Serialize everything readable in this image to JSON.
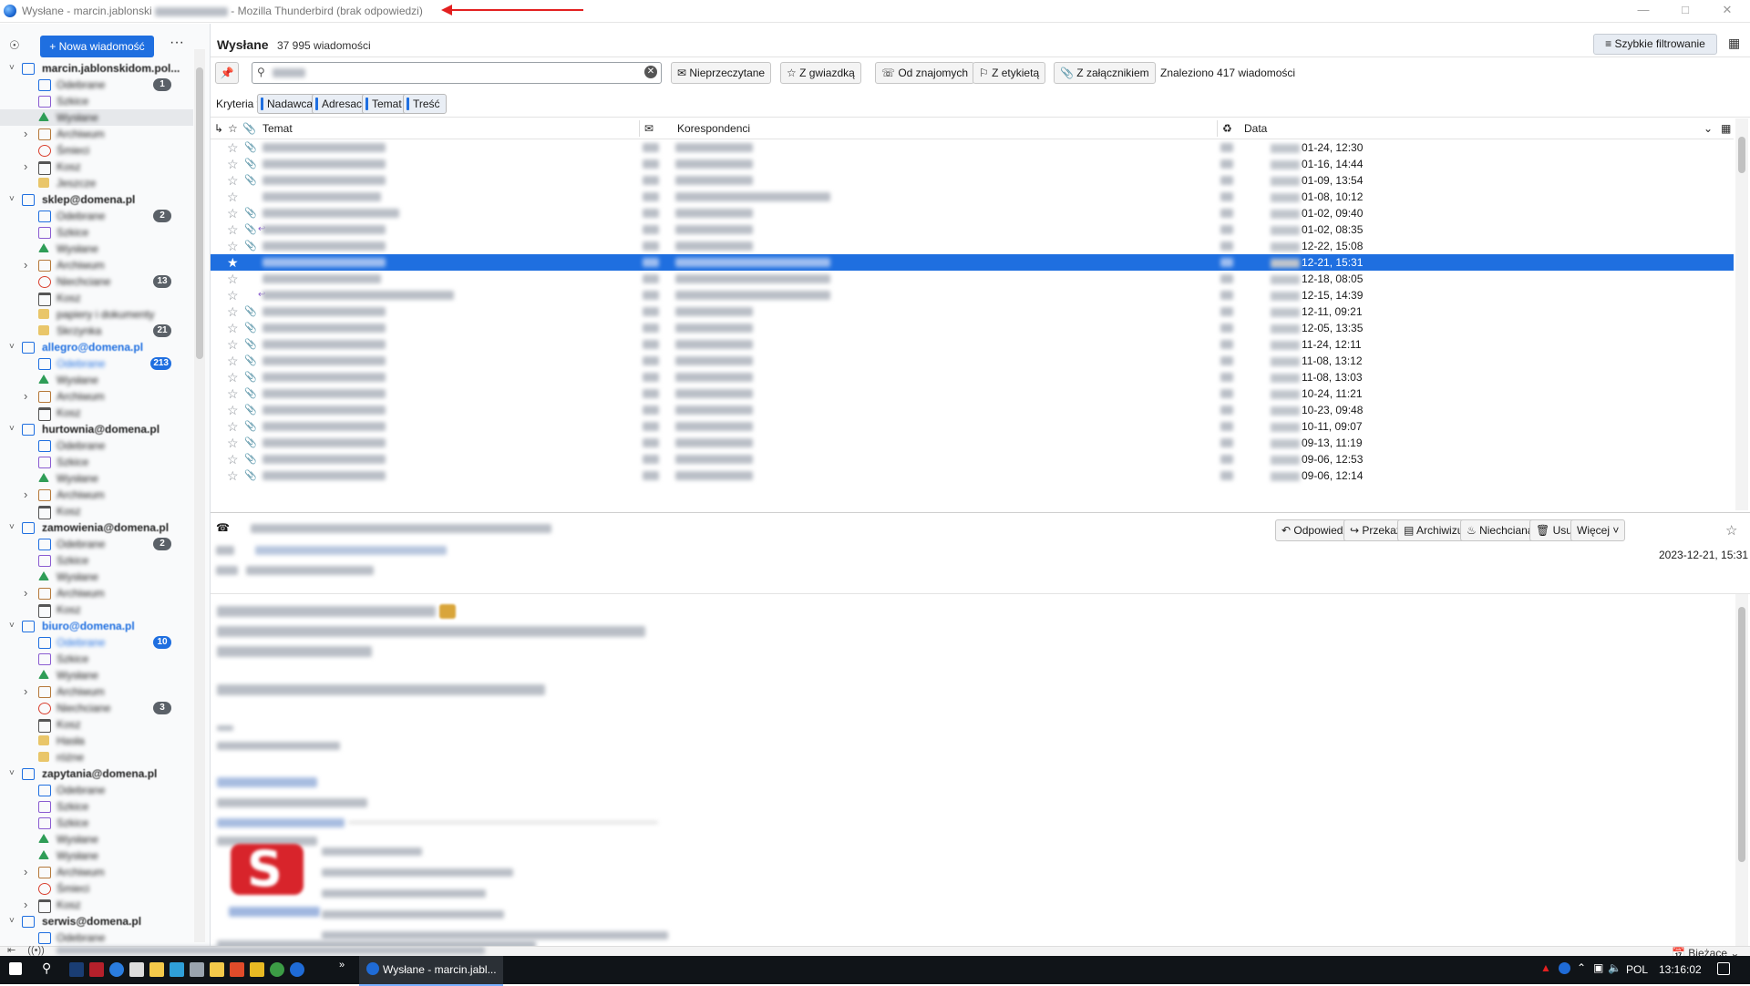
{
  "window": {
    "title": "Wysłane - marcin.jablonski",
    "title_suffix": "- Mozilla Thunderbird (brak odpowiedzi)",
    "accent": "#1f6fe0"
  },
  "folder_pane": {
    "new_message": "+ Nowa wiadomość",
    "menu": "···",
    "items": [
      {
        "type": "acct",
        "label": "marcin.jablonskidom.pol...",
        "expanded": true
      },
      {
        "type": "folder",
        "label": "Odebrane",
        "icon": "inbox-icon",
        "badge": "1"
      },
      {
        "type": "folder",
        "label": "Szkice",
        "icon": "drafts-icon"
      },
      {
        "type": "folder",
        "label": "Wysłane",
        "icon": "sent-icon",
        "selected": true
      },
      {
        "type": "folder",
        "label": "Archiwum",
        "icon": "archive-icon",
        "twisty": true
      },
      {
        "type": "folder",
        "label": "Śmieci",
        "icon": "junk-icon"
      },
      {
        "type": "folder",
        "label": "Kosz",
        "icon": "trash-icon",
        "twisty": true
      },
      {
        "type": "folder",
        "label": "Jeszcze",
        "icon": "folder-icon"
      },
      {
        "type": "acct",
        "label": "sklep@domena.pl",
        "expanded": true
      },
      {
        "type": "folder",
        "label": "Odebrane",
        "icon": "inbox-icon",
        "badge": "2"
      },
      {
        "type": "folder",
        "label": "Szkice",
        "icon": "drafts-icon"
      },
      {
        "type": "folder",
        "label": "Wysłane",
        "icon": "sent-icon"
      },
      {
        "type": "folder",
        "label": "Archiwum",
        "icon": "archive-icon",
        "twisty": true
      },
      {
        "type": "folder",
        "label": "Niechciane",
        "icon": "junk-icon",
        "badge": "13"
      },
      {
        "type": "folder",
        "label": "Kosz",
        "icon": "trash-icon"
      },
      {
        "type": "folder",
        "label": "papiery i dokumenty",
        "icon": "folder-icon"
      },
      {
        "type": "folder",
        "label": "Skrzynka",
        "icon": "folder-icon",
        "badge": "21"
      },
      {
        "type": "acct",
        "label": "allegro@domena.pl",
        "expanded": true,
        "blue": true
      },
      {
        "type": "folder",
        "label": "Odebrane",
        "icon": "inbox-icon",
        "badge": "213",
        "badgeBlue": true,
        "blue": true
      },
      {
        "type": "folder",
        "label": "Wysłane",
        "icon": "sent-icon"
      },
      {
        "type": "folder",
        "label": "Archiwum",
        "icon": "archive-icon",
        "twisty": true
      },
      {
        "type": "folder",
        "label": "Kosz",
        "icon": "trash-icon"
      },
      {
        "type": "acct",
        "label": "hurtownia@domena.pl",
        "expanded": true
      },
      {
        "type": "folder",
        "label": "Odebrane",
        "icon": "inbox-icon"
      },
      {
        "type": "folder",
        "label": "Szkice",
        "icon": "drafts-icon"
      },
      {
        "type": "folder",
        "label": "Wysłane",
        "icon": "sent-icon"
      },
      {
        "type": "folder",
        "label": "Archiwum",
        "icon": "archive-icon",
        "twisty": true
      },
      {
        "type": "folder",
        "label": "Kosz",
        "icon": "trash-icon"
      },
      {
        "type": "acct",
        "label": "zamowienia@domena.pl",
        "expanded": true
      },
      {
        "type": "folder",
        "label": "Odebrane",
        "icon": "inbox-icon",
        "badge": "2"
      },
      {
        "type": "folder",
        "label": "Szkice",
        "icon": "drafts-icon"
      },
      {
        "type": "folder",
        "label": "Wysłane",
        "icon": "sent-icon"
      },
      {
        "type": "folder",
        "label": "Archiwum",
        "icon": "archive-icon",
        "twisty": true
      },
      {
        "type": "folder",
        "label": "Kosz",
        "icon": "trash-icon"
      },
      {
        "type": "acct",
        "label": "biuro@domena.pl",
        "expanded": true,
        "blue": true
      },
      {
        "type": "folder",
        "label": "Odebrane",
        "icon": "inbox-icon",
        "badge": "10",
        "badgeBlue": true,
        "blue": true
      },
      {
        "type": "folder",
        "label": "Szkice",
        "icon": "drafts-icon"
      },
      {
        "type": "folder",
        "label": "Wysłane",
        "icon": "sent-icon"
      },
      {
        "type": "folder",
        "label": "Archiwum",
        "icon": "archive-icon",
        "twisty": true
      },
      {
        "type": "folder",
        "label": "Niechciane",
        "icon": "junk-icon",
        "badge": "3"
      },
      {
        "type": "folder",
        "label": "Kosz",
        "icon": "trash-icon"
      },
      {
        "type": "folder",
        "label": "Hasła",
        "icon": "folder-icon"
      },
      {
        "type": "folder",
        "label": "różne",
        "icon": "folder-icon"
      },
      {
        "type": "acct",
        "label": "zapytania@domena.pl",
        "expanded": true
      },
      {
        "type": "folder",
        "label": "Odebrane",
        "icon": "inbox-icon"
      },
      {
        "type": "folder",
        "label": "Szkice",
        "icon": "drafts-icon"
      },
      {
        "type": "folder",
        "label": "Szkice",
        "icon": "drafts-icon"
      },
      {
        "type": "folder",
        "label": "Wysłane",
        "icon": "sent-icon"
      },
      {
        "type": "folder",
        "label": "Wysłane",
        "icon": "sent-icon"
      },
      {
        "type": "folder",
        "label": "Archiwum",
        "icon": "archive-icon",
        "twisty": true
      },
      {
        "type": "folder",
        "label": "Śmieci",
        "icon": "junk-icon"
      },
      {
        "type": "folder",
        "label": "Kosz",
        "icon": "trash-icon",
        "twisty": true
      },
      {
        "type": "acct",
        "label": "serwis@domena.pl",
        "expanded": true
      },
      {
        "type": "folder",
        "label": "Odebrane",
        "icon": "inbox-icon"
      }
    ]
  },
  "header": {
    "folder": "Wysłane",
    "count": "37 995 wiadomości",
    "quick_filter": "Szybkie filtrowanie"
  },
  "quickfilter": {
    "search_value": "",
    "buttons": [
      "Nieprzeczytane",
      "Z gwiazdką",
      "Od znajomych",
      "Z etykietą",
      "Z załącznikiem"
    ],
    "found": "Znaleziono 417 wiadomości",
    "criteria_label": "Kryteria filtrowania:",
    "criteria": [
      "Nadawca",
      "Adresaci",
      "Temat",
      "Treść"
    ]
  },
  "columns": {
    "subject": "Temat",
    "correspondents": "Korespondenci",
    "date": "Data"
  },
  "messages": [
    {
      "date": "01-24, 12:30",
      "clip": true,
      "sw": 135,
      "cw": 85
    },
    {
      "date": "01-16, 14:44",
      "clip": true,
      "sw": 135,
      "cw": 85
    },
    {
      "date": "01-09, 13:54",
      "clip": true,
      "sw": 135,
      "cw": 85
    },
    {
      "date": "01-08, 10:12",
      "clip": false,
      "sw": 130,
      "cw": 170
    },
    {
      "date": "01-02, 09:40",
      "clip": true,
      "sw": 150,
      "cw": 85
    },
    {
      "date": "01-02, 08:35",
      "clip": true,
      "sw": 135,
      "cw": 85,
      "replied": true
    },
    {
      "date": "12-22, 15:08",
      "clip": true,
      "sw": 135,
      "cw": 85
    },
    {
      "date": "12-21, 15:31",
      "clip": false,
      "sw": 135,
      "cw": 170,
      "selected": true
    },
    {
      "date": "12-18, 08:05",
      "clip": false,
      "sw": 130,
      "cw": 170
    },
    {
      "date": "12-15, 14:39",
      "clip": false,
      "sw": 210,
      "cw": 170,
      "replied": true
    },
    {
      "date": "12-11, 09:21",
      "clip": true,
      "sw": 135,
      "cw": 85
    },
    {
      "date": "12-05, 13:35",
      "clip": true,
      "sw": 135,
      "cw": 85
    },
    {
      "date": "11-24, 12:11",
      "clip": true,
      "sw": 135,
      "cw": 85
    },
    {
      "date": "11-08, 13:12",
      "clip": true,
      "sw": 135,
      "cw": 85
    },
    {
      "date": "11-08, 13:03",
      "clip": true,
      "sw": 135,
      "cw": 85
    },
    {
      "date": "10-24, 11:21",
      "clip": true,
      "sw": 135,
      "cw": 85
    },
    {
      "date": "10-23, 09:48",
      "clip": true,
      "sw": 135,
      "cw": 85
    },
    {
      "date": "10-11, 09:07",
      "clip": true,
      "sw": 135,
      "cw": 85
    },
    {
      "date": "09-13, 11:19",
      "clip": true,
      "sw": 135,
      "cw": 85
    },
    {
      "date": "09-06, 12:53",
      "clip": true,
      "sw": 135,
      "cw": 85
    },
    {
      "date": "09-06, 12:14",
      "clip": true,
      "sw": 135,
      "cw": 85
    }
  ],
  "message_header": {
    "buttons": [
      "Odpowiedz",
      "Przekaż",
      "Archiwizuj",
      "Niechciana",
      "Usuń",
      "Więcej"
    ],
    "date": "2023-12-21, 15:31"
  },
  "status": {
    "view": "Bieżące"
  },
  "taskbar": {
    "active": "Wysłane - marcin.jabl...",
    "lang": "POL",
    "time": "13:16:02"
  }
}
